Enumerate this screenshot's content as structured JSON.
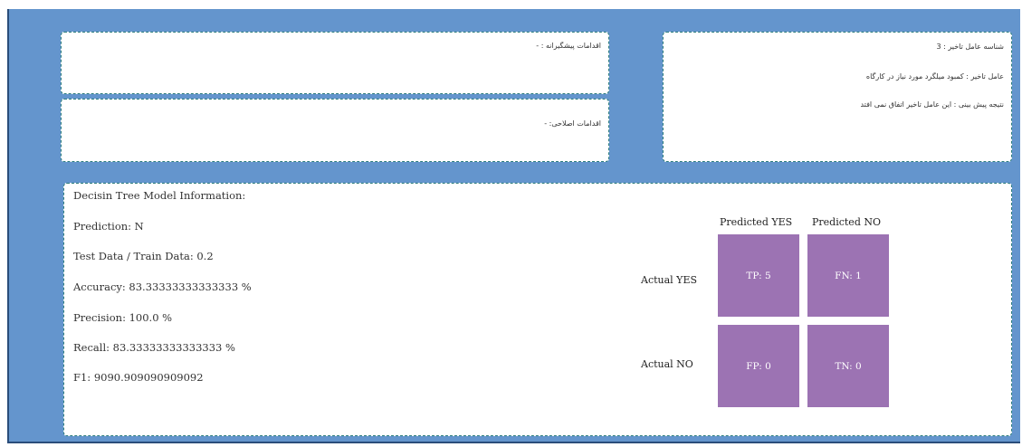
{
  "preventive": {
    "text": "اقدامات پیشگیرانه : -"
  },
  "corrective": {
    "text": "اقدامات اصلاحی: -"
  },
  "factor": {
    "id_text": "شناسه عامل تاخیر : 3",
    "name_text": "عامل تاخیر : کمبود میلگرد مورد نیاز در کارگاه",
    "prediction_text": "نتیجه پیش بینی : این عامل تاخیر اتفاق نمی افتد"
  },
  "model": {
    "title": "Decisin Tree Model Information:",
    "prediction": "Prediction: N",
    "test_train": "Test Data / Train Data: 0.2",
    "accuracy": "Accuracy: 83.33333333333333 %",
    "precision": "Precision: 100.0 %",
    "recall": "Recall: 83.33333333333333 %",
    "f1": "F1: 9090.909090909092"
  },
  "confusion_matrix": {
    "col_yes": "Predicted YES",
    "col_no": "Predicted NO",
    "row_yes": "Actual YES",
    "row_no": "Actual NO",
    "tp": "TP: 5",
    "fn": "FN: 1",
    "fp": "FP: 0",
    "tn": "TN: 0",
    "cell_color": "#9c73b3"
  },
  "colors": {
    "background": "#6495cd",
    "panel": "#ffffff",
    "panel_border": "#2e7d7d"
  }
}
